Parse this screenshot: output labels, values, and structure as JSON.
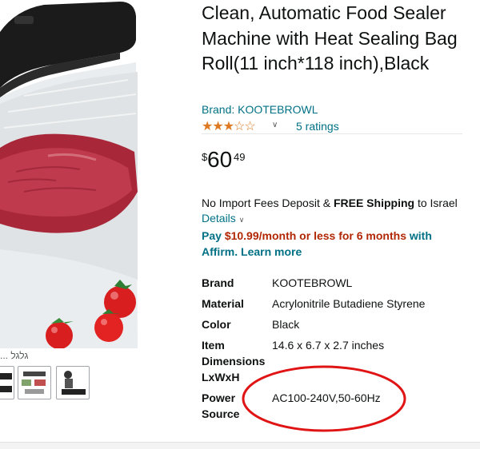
{
  "product": {
    "title": "Clean, Automatic Food Sealer Machine with Heat Sealing Bag Roll(11 inch*118 inch),Black",
    "brand_link": "Brand: KOOTEBROWL",
    "rating": {
      "stars": 3.0,
      "max": 5,
      "ratings_link": "5 ratings"
    },
    "price": {
      "symbol": "$",
      "whole": "60",
      "fraction": "49"
    },
    "shipping": {
      "pre": "No Import Fees Deposit & ",
      "bold": "FREE Shipping",
      "post": " to Israel",
      "details_link": "Details"
    },
    "affirm": {
      "pay": "Pay ",
      "amount": "$10.99/month or less for 6 months",
      "with": " with",
      "affirm_word": "Affirm.",
      "learn_more": "Learn more"
    },
    "specs": [
      {
        "key": "Brand",
        "value": "KOOTEBROWL"
      },
      {
        "key": "Material",
        "value": "Acrylonitrile Butadiene Styrene"
      },
      {
        "key": "Color",
        "value": "Black"
      },
      {
        "key": "Item Dimensions LxWxH",
        "value": "14.6 x 6.7 x 2.7 inches"
      },
      {
        "key": "Power Source",
        "value": "AC100-240V,50-60Hz"
      }
    ]
  },
  "gallery": {
    "hover_caption": "גלגל ...",
    "annotation_color": "#e01414"
  },
  "colors": {
    "link": "#007185",
    "star": "#de7921",
    "price_red": "#b12704"
  }
}
